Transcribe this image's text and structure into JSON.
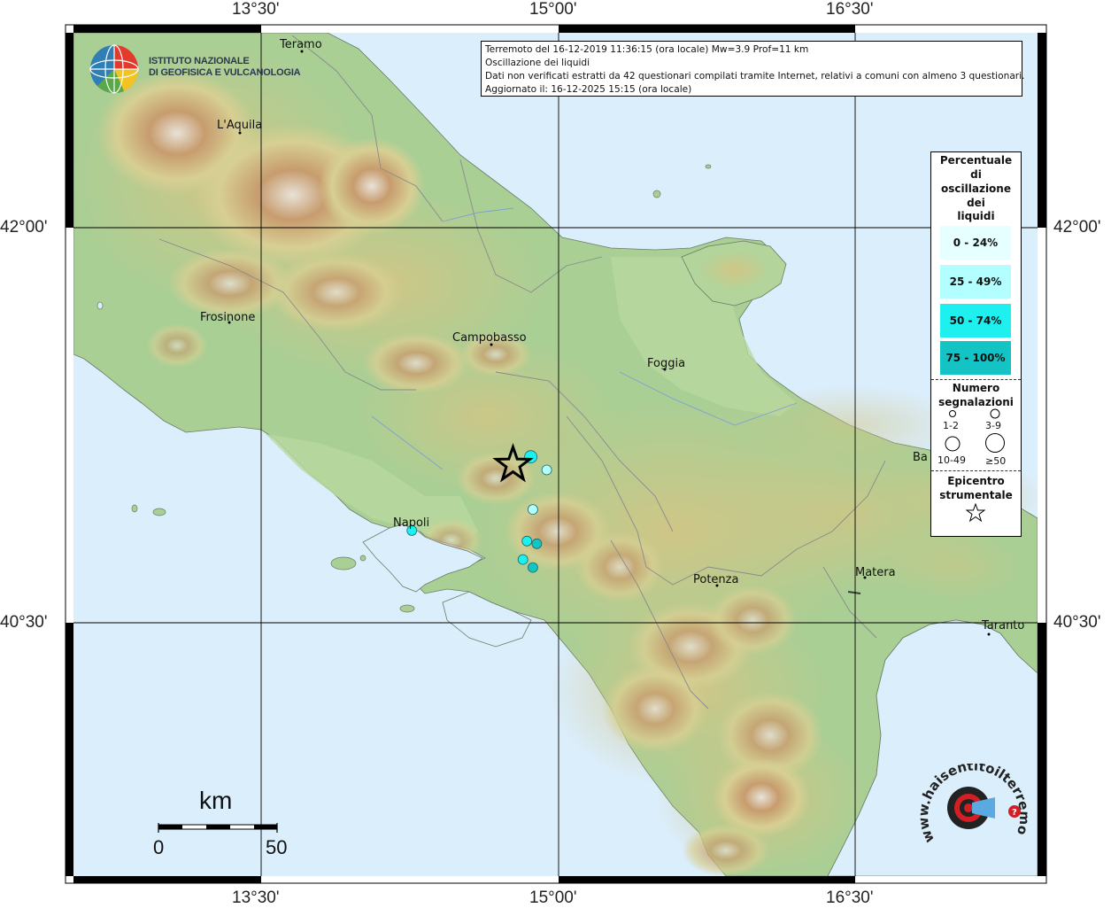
{
  "info": {
    "line1": "Terremoto del 16-12-2019 11:36:15 (ora locale) Mw=3.9 Prof=11 km",
    "line2": "Oscillazione dei liquidi",
    "line3": "Dati non verificati estratti da 42 questionari compilati tramite Internet, relativi a comuni con almeno 3 questionari.",
    "line4": "Aggiornato il: 16-12-2025 15:15 (ora locale)"
  },
  "logo": {
    "line1": "ISTITUTO NAZIONALE",
    "line2": "DI GEOFISICA E VULCANOLOGIA"
  },
  "frame": {
    "top": [
      "13°30'",
      "15°00'",
      "16°30'"
    ],
    "bottom": [
      "13°30'",
      "15°00'",
      "16°30'"
    ],
    "left": [
      "42°00'",
      "40°30'"
    ],
    "right": [
      "42°00'",
      "40°30'"
    ]
  },
  "cities": {
    "teramo": "Teramo",
    "laquila": "L'Aquila",
    "frosinone": "Frosinone",
    "campobasso": "Campobasso",
    "foggia": "Foggia",
    "napoli": "Napoli",
    "potenza": "Potenza",
    "matera": "Matera",
    "bari": "Ba",
    "taranto": "Taranto"
  },
  "legend": {
    "title_lines": [
      "Percentuale",
      "di",
      "oscillazione",
      "dei",
      "liquidi"
    ],
    "classes": [
      {
        "label": "0 - 24%",
        "color": "#e6ffff"
      },
      {
        "label": "25 - 49%",
        "color": "#b3ffff"
      },
      {
        "label": "50 - 74%",
        "color": "#1ef0f0"
      },
      {
        "label": "75 - 100%",
        "color": "#14c3c3"
      }
    ],
    "count_title_lines": [
      "Numero",
      "segnalazioni"
    ],
    "count_labels": [
      "1-2",
      "3-9",
      "10-49",
      "≥50"
    ],
    "epicenter_title_lines": [
      "Epicentro",
      "strumentale"
    ]
  },
  "scale": {
    "unit": "km",
    "start": "0",
    "end": "50"
  },
  "observations": [
    {
      "lon": 14.86,
      "lat": 41.13,
      "percent": 60,
      "count": 3
    },
    {
      "lon": 14.94,
      "lat": 41.08,
      "percent": 40,
      "count": 1
    },
    {
      "lon": 14.87,
      "lat": 40.93,
      "percent": 40,
      "count": 1
    },
    {
      "lon": 14.84,
      "lat": 40.81,
      "percent": 60,
      "count": 1
    },
    {
      "lon": 14.89,
      "lat": 40.8,
      "percent": 80,
      "count": 1
    },
    {
      "lon": 14.82,
      "lat": 40.74,
      "percent": 60,
      "count": 1
    },
    {
      "lon": 14.87,
      "lat": 40.71,
      "percent": 80,
      "count": 1
    },
    {
      "lon": 14.26,
      "lat": 40.85,
      "percent": 60,
      "count": 1
    }
  ],
  "epicenter": {
    "lon": 14.77,
    "lat": 41.1
  },
  "colors": {
    "sea": "#dbeefc",
    "lowland": "#a9cf95",
    "hill": "#d8d49a",
    "mountain": "#c9a277",
    "peak": "#f1ebe4",
    "star": "#000000"
  },
  "watermark": "www.haisentitoilterremoto.it"
}
